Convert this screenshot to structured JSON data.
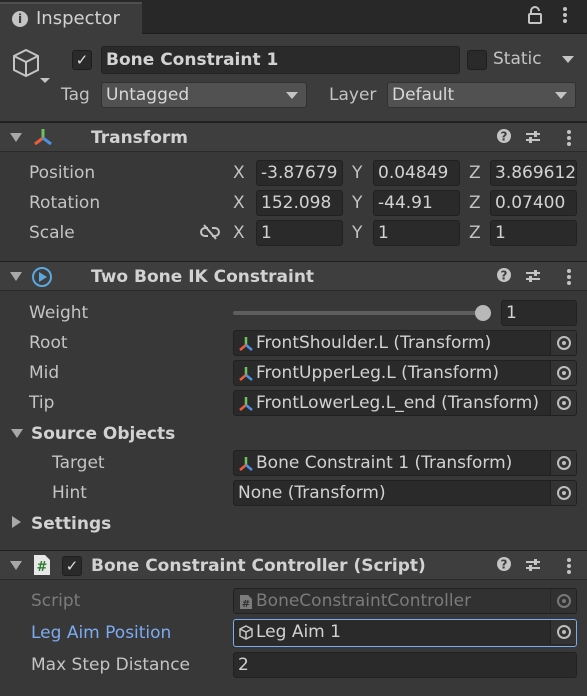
{
  "tab": {
    "title": "Inspector"
  },
  "header": {
    "object_active": true,
    "name": "Bone Constraint 1",
    "static_label": "Static",
    "tag_label": "Tag",
    "tag_value": "Untagged",
    "layer_label": "Layer",
    "layer_value": "Default"
  },
  "transform": {
    "title": "Transform",
    "position_label": "Position",
    "rotation_label": "Rotation",
    "scale_label": "Scale",
    "position": {
      "x": "-3.87679",
      "y": "0.04849",
      "z": "3.869612"
    },
    "rotation": {
      "x": "152.098",
      "y": "-44.91",
      "z": "0.07400"
    },
    "scale": {
      "x": "1",
      "y": "1",
      "z": "1"
    },
    "axis_x": "X",
    "axis_y": "Y",
    "axis_z": "Z"
  },
  "ik": {
    "title": "Two Bone IK Constraint",
    "weight_label": "Weight",
    "weight_value": "1",
    "weight_fraction": 1.0,
    "root_label": "Root",
    "root_value": "FrontShoulder.L (Transform)",
    "mid_label": "Mid",
    "mid_value": "FrontUpperLeg.L (Transform)",
    "tip_label": "Tip",
    "tip_value": "FrontLowerLeg.L_end (Transform)",
    "source_label": "Source Objects",
    "target_label": "Target",
    "target_value": "Bone Constraint 1 (Transform)",
    "hint_label": "Hint",
    "hint_value": "None (Transform)",
    "settings_label": "Settings"
  },
  "script": {
    "title": "Bone Constraint Controller (Script)",
    "enabled": true,
    "script_label": "Script",
    "script_value": "BoneConstraintController",
    "aim_label": "Leg Aim Position",
    "aim_value": "Leg Aim 1",
    "step_label": "Max Step Distance",
    "step_value": "2"
  },
  "colors": {
    "accent": "#7babf1",
    "background": "#383838",
    "field": "#2a2a2a"
  }
}
